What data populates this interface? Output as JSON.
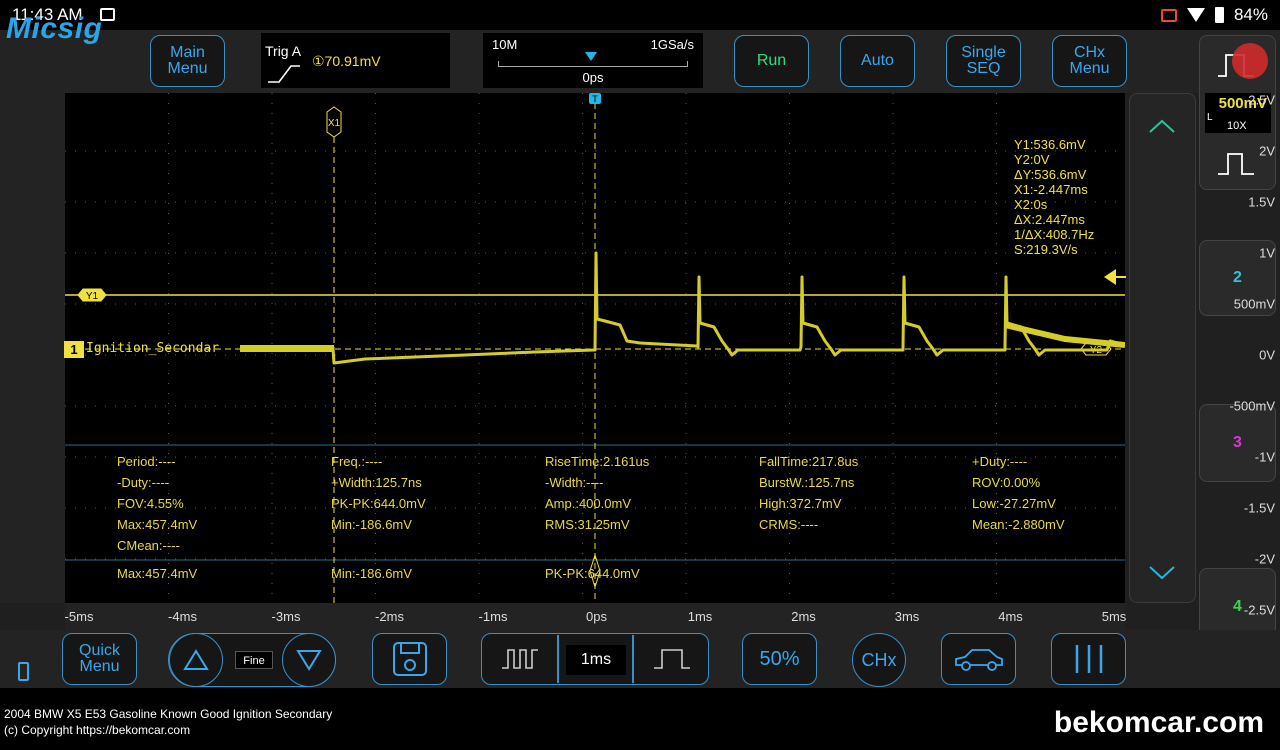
{
  "status_bar": {
    "time": "11:43 AM",
    "battery": "84%"
  },
  "header": {
    "logo": "Micsig",
    "main_menu": [
      "Main",
      "Menu"
    ],
    "trigger": {
      "label": "Trig A",
      "value": "①70.91mV"
    },
    "timebase": {
      "memory": "10M",
      "sample_rate": "1GSa/s",
      "position": "0ps"
    },
    "run": "Run",
    "auto": "Auto",
    "single": [
      "Single",
      "SEQ"
    ],
    "chx_menu": [
      "CHx",
      "Menu"
    ]
  },
  "channels": {
    "ch1_scale": "500mV",
    "ch1_coupling": "L",
    "ch1_probe": "10X",
    "ch2": "2",
    "ch3": "3",
    "ch4": "4",
    "ch1_tag": "1",
    "ch1_name": "Ignition_Secondar"
  },
  "axes": {
    "y_labels": [
      "2.5V",
      "2V",
      "1.5V",
      "1V",
      "500mV",
      "0V",
      "-500mV",
      "-1V",
      "-1.5V",
      "-2V",
      "-2.5V"
    ],
    "x_labels": [
      "-5ms",
      "-4ms",
      "-3ms",
      "-2ms",
      "-1ms",
      "0ps",
      "1ms",
      "2ms",
      "3ms",
      "4ms",
      "5ms"
    ]
  },
  "cursors": {
    "x1_tag": "X1",
    "y1_tag": "Y1",
    "y2_tag": "Y2",
    "trigger_tag": "T",
    "readout": [
      "Y1:536.6mV",
      "Y2:0V",
      "ΔY:536.6mV",
      "X1:-2.447ms",
      "X2:0s",
      "ΔX:2.447ms",
      "1/ΔX:408.7Hz",
      "S:219.3V/s"
    ]
  },
  "measurements": {
    "col1": [
      "Period:----",
      "-Duty:----",
      "FOV:4.55%",
      "Max:457.4mV",
      "CMean:----"
    ],
    "col2": [
      "Freq.:----",
      "+Width:125.7ns",
      "PK-PK:644.0mV",
      "Min:-186.6mV"
    ],
    "col3": [
      "RiseTime:2.161us",
      "-Width:----",
      "Amp.:400.0mV",
      "RMS:31.25mV"
    ],
    "col4": [
      "FallTime:217.8us",
      "BurstW.:125.7ns",
      "High:372.7mV",
      "CRMS:----"
    ],
    "col5": [
      "+Duty:----",
      "ROV:0.00%",
      "Low:-27.27mV",
      "Mean:-2.880mV"
    ],
    "summary": [
      "Max:457.4mV",
      "Min:-186.6mV",
      "PK-PK:644.0mV"
    ]
  },
  "bottom_bar": {
    "quick_menu": [
      "Quick",
      "Menu"
    ],
    "fine": "Fine",
    "time_div": "1ms",
    "fifty": "50%",
    "chx": "CHx"
  },
  "caption": {
    "line1": "2004 BMW X5 E53 Gasoline Known Good Ignition Secondary",
    "line2": "(c) Copyright https://bekomcar.com",
    "brand": "bekomcar.com"
  },
  "colors": {
    "trace": "#d4cc28",
    "accent": "#3aa7ec",
    "cursor": "#f0e040"
  }
}
